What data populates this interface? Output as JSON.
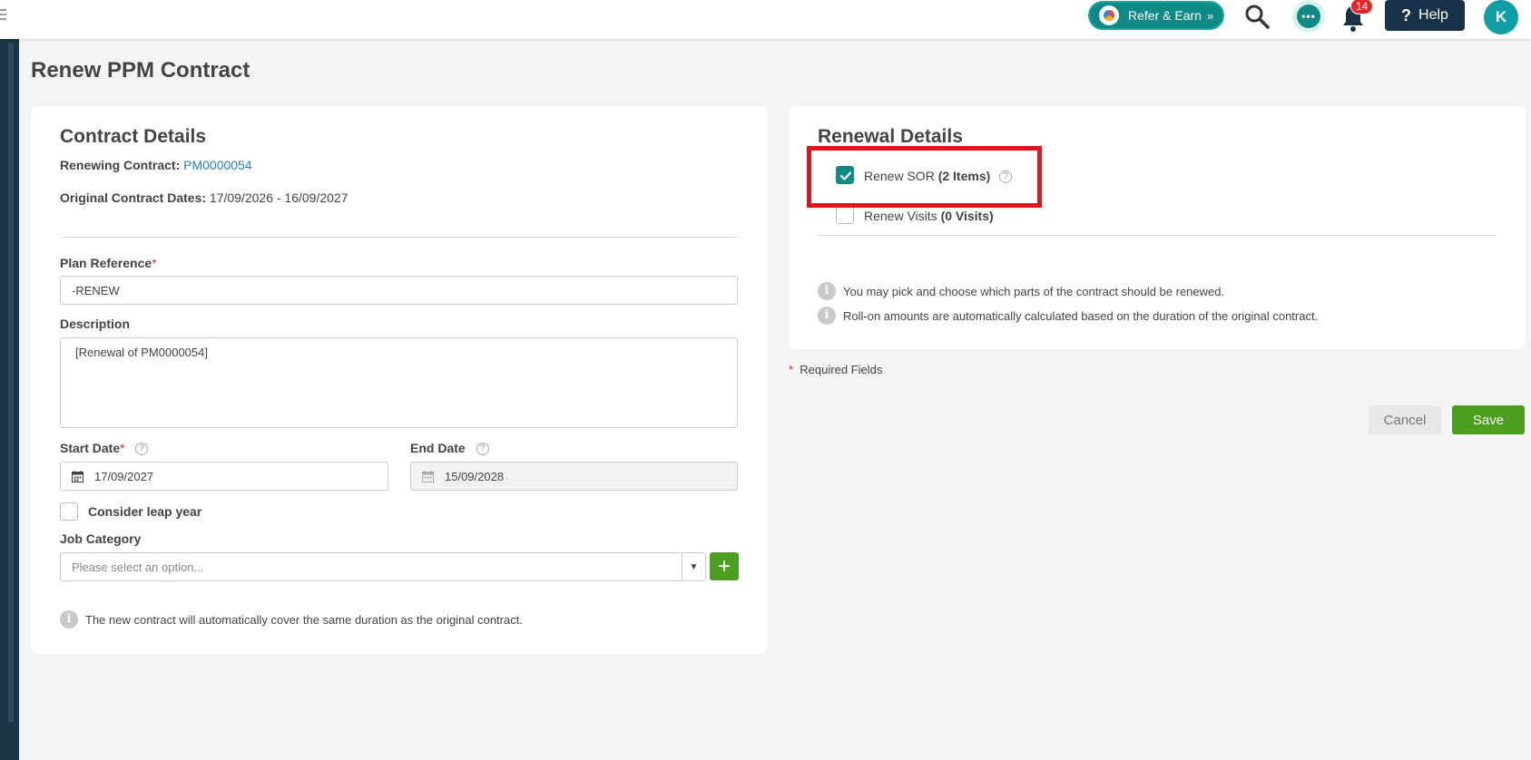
{
  "header": {
    "refer_label": "Refer & Earn",
    "refer_chevron": "»",
    "notification_count": "14",
    "help_label": "Help",
    "help_glyph": "?",
    "avatar_initial": "K",
    "chat_glyph": "•••"
  },
  "page": {
    "title": "Renew PPM Contract"
  },
  "contract_details": {
    "heading": "Contract Details",
    "renewing_label": "Renewing Contract:",
    "renewing_value": "PM0000054",
    "original_dates_label": "Original Contract Dates:",
    "original_dates_value": "17/09/2026 - 16/09/2027",
    "plan_reference_label": "Plan Reference",
    "plan_reference_value": "-RENEW",
    "description_label": "Description",
    "description_value": "[Renewal of PM0000054]",
    "start_date_label": "Start Date",
    "start_date_value": "17/09/2027",
    "end_date_label": "End Date",
    "end_date_value": "15/09/2028",
    "leap_year_label": "Consider leap year",
    "job_category_label": "Job Category",
    "job_category_placeholder": "Please select an option...",
    "info_text": "The new contract will automatically cover the same duration as the original contract.",
    "required_star": "*"
  },
  "renewal_details": {
    "heading": "Renewal Details",
    "renew_sor_label": "Renew SOR",
    "renew_sor_count": "(2 Items)",
    "renew_visits_label": "Renew Visits",
    "renew_visits_count": "(0 Visits)",
    "info_1": "You may pick and choose which parts of the contract should be renewed.",
    "info_2": "Roll-on amounts are automatically calculated based on the duration of the original contract."
  },
  "footer": {
    "required_star": "*",
    "required_text": "Required Fields",
    "cancel_label": "Cancel",
    "save_label": "Save"
  },
  "icons": {
    "info": "i",
    "question": "?"
  },
  "colors": {
    "brand_teal": "#0f8a84",
    "save_green": "#4c9e1e",
    "highlight_red": "#e0141a",
    "help_navy": "#183349"
  }
}
